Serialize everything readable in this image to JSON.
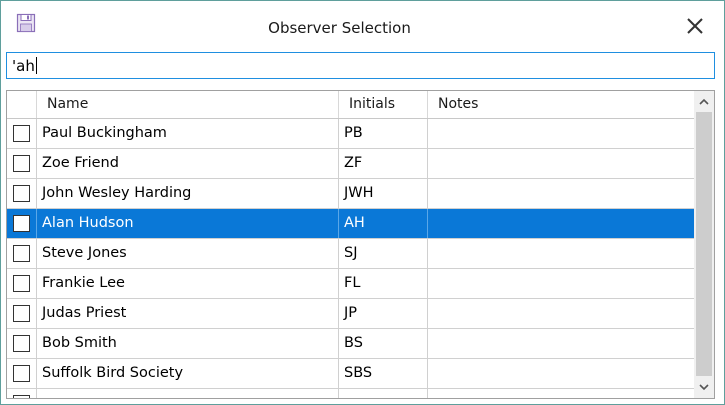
{
  "window": {
    "title": "Observer Selection",
    "icon": "save-icon",
    "close_icon": "close-icon"
  },
  "search": {
    "value": "'ah"
  },
  "table": {
    "columns": [
      "Name",
      "Initials",
      "Notes"
    ],
    "rows": [
      {
        "name": "Paul Buckingham",
        "initials": "PB",
        "notes": "",
        "checked": false,
        "selected": false
      },
      {
        "name": "Zoe Friend",
        "initials": "ZF",
        "notes": "",
        "checked": false,
        "selected": false
      },
      {
        "name": "John Wesley Harding",
        "initials": "JWH",
        "notes": "",
        "checked": false,
        "selected": false
      },
      {
        "name": "Alan Hudson",
        "initials": "AH",
        "notes": "",
        "checked": false,
        "selected": true
      },
      {
        "name": "Steve Jones",
        "initials": "SJ",
        "notes": "",
        "checked": false,
        "selected": false
      },
      {
        "name": "Frankie Lee",
        "initials": "FL",
        "notes": "",
        "checked": false,
        "selected": false
      },
      {
        "name": "Judas Priest",
        "initials": "JP",
        "notes": "",
        "checked": false,
        "selected": false
      },
      {
        "name": "Bob Smith",
        "initials": "BS",
        "notes": "",
        "checked": false,
        "selected": false
      },
      {
        "name": "Suffolk Bird Society",
        "initials": "SBS",
        "notes": "",
        "checked": false,
        "selected": false
      },
      {
        "name": "",
        "initials": "",
        "notes": "",
        "checked": false,
        "selected": false
      }
    ]
  },
  "colors": {
    "selection": "#0a78d7",
    "border_accent": "#1f8fe0",
    "window_border": "#5f9f9c"
  }
}
